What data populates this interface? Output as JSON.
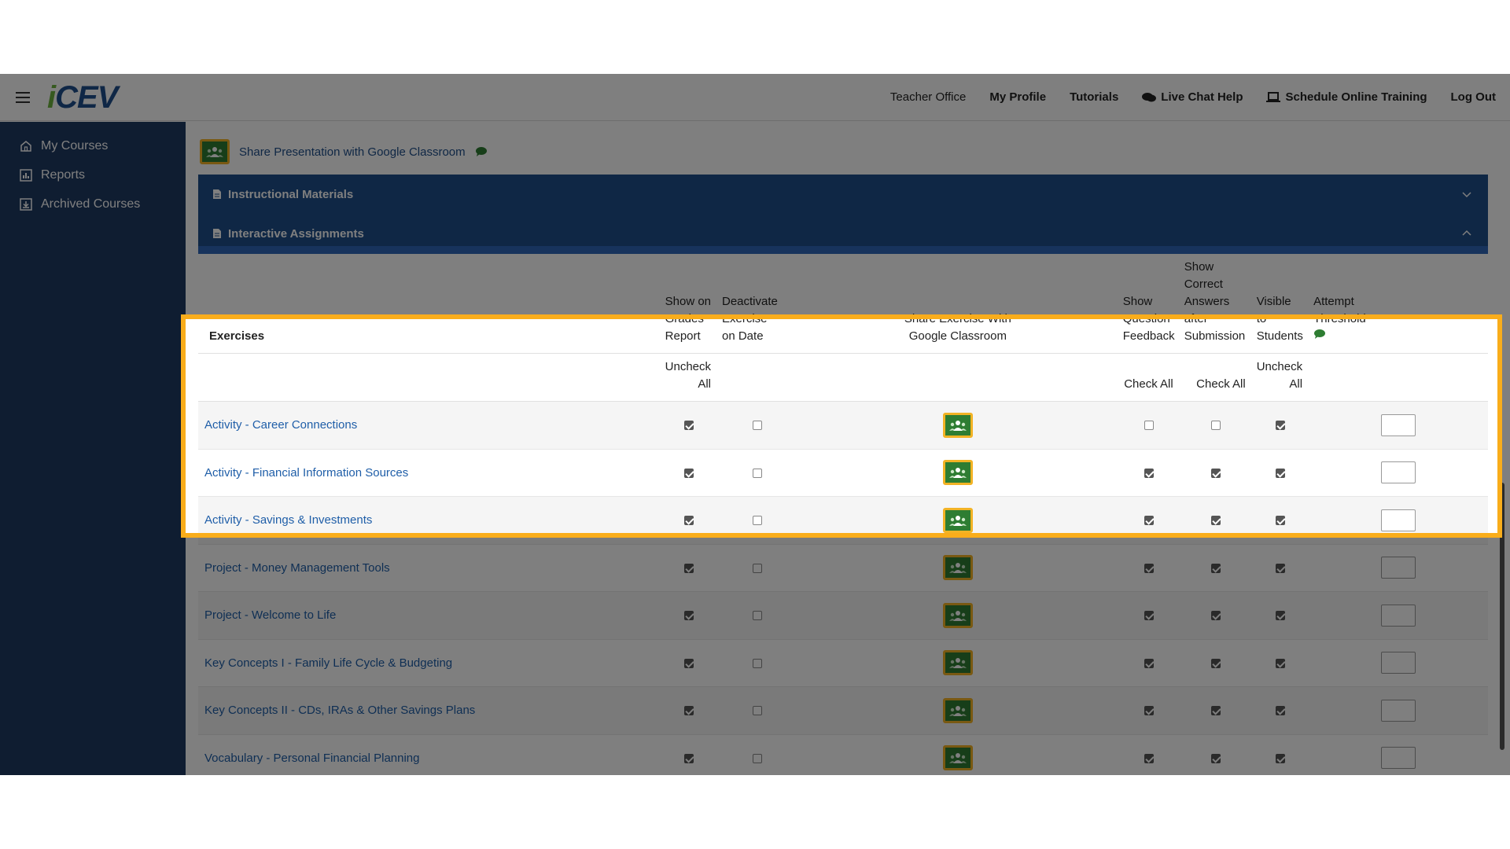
{
  "topbar": {
    "logo_i": "i",
    "logo_cev": "CEV",
    "teacher_office": "Teacher Office",
    "my_profile": "My Profile",
    "tutorials": "Tutorials",
    "live_chat": "Live Chat Help",
    "schedule_training": "Schedule Online Training",
    "log_out": "Log Out"
  },
  "sidebar": {
    "items": [
      {
        "label": "My Courses",
        "icon": "home-icon"
      },
      {
        "label": "Reports",
        "icon": "report-icon"
      },
      {
        "label": "Archived Courses",
        "icon": "archive-icon"
      }
    ]
  },
  "main": {
    "share_presentation": "Share Presentation with Google Classroom",
    "panels": [
      {
        "title": "Instructional Materials",
        "state": "collapsed"
      },
      {
        "title": "Interactive Assignments",
        "state": "expanded"
      }
    ]
  },
  "table": {
    "headers": {
      "exercises": "Exercises",
      "show_grades_1": "Show on",
      "show_grades_2": "Grades",
      "show_grades_3": "Report",
      "deactivate_1": "Deactivate",
      "deactivate_2": "Exercise",
      "deactivate_3": "on Date",
      "share_1": "Share Exercise With",
      "share_2": "Google Classroom",
      "feedback_1": "Show",
      "feedback_2": "Question",
      "feedback_3": "Feedback",
      "correct_1": "Show",
      "correct_2": "Correct",
      "correct_3": "Answers",
      "correct_4": "after",
      "correct_5": "Submission",
      "visible_1": "Visible",
      "visible_2": "to",
      "visible_3": "Students",
      "attempt_1": "Attempt",
      "attempt_2": "Threshold"
    },
    "controls": {
      "grades_1": "Uncheck",
      "grades_2": "All",
      "feedback": "Check All",
      "correct": "Check All",
      "visible_1": "Uncheck",
      "visible_2": "All"
    },
    "rows": [
      {
        "name": "Activity - Career Connections",
        "grades": true,
        "deactivate": false,
        "feedback": false,
        "correct": false,
        "visible": true,
        "threshold": ""
      },
      {
        "name": "Activity - Financial Information Sources",
        "grades": true,
        "deactivate": false,
        "feedback": true,
        "correct": true,
        "visible": true,
        "threshold": ""
      },
      {
        "name": "Activity - Savings & Investments",
        "grades": true,
        "deactivate": false,
        "feedback": true,
        "correct": true,
        "visible": true,
        "threshold": ""
      },
      {
        "name": "Project - Money Management Tools",
        "grades": true,
        "deactivate": false,
        "feedback": true,
        "correct": true,
        "visible": true,
        "threshold": ""
      },
      {
        "name": "Project - Welcome to Life",
        "grades": true,
        "deactivate": false,
        "feedback": true,
        "correct": true,
        "visible": true,
        "threshold": ""
      },
      {
        "name": "Key Concepts I - Family Life Cycle & Budgeting",
        "grades": true,
        "deactivate": false,
        "feedback": true,
        "correct": true,
        "visible": true,
        "threshold": ""
      },
      {
        "name": "Key Concepts II - CDs, IRAs & Other Savings Plans",
        "grades": true,
        "deactivate": false,
        "feedback": true,
        "correct": true,
        "visible": true,
        "threshold": ""
      },
      {
        "name": "Vocabulary - Personal Financial Planning",
        "grades": true,
        "deactivate": false,
        "feedback": true,
        "correct": true,
        "visible": true,
        "threshold": ""
      }
    ]
  },
  "colors": {
    "sidebar": "#1f3a63",
    "panel": "#1f4e8a",
    "highlight": "#f9ad1b",
    "link": "#1f5ea8",
    "gc_green": "#2e7d32",
    "gc_border": "#f2b325"
  }
}
